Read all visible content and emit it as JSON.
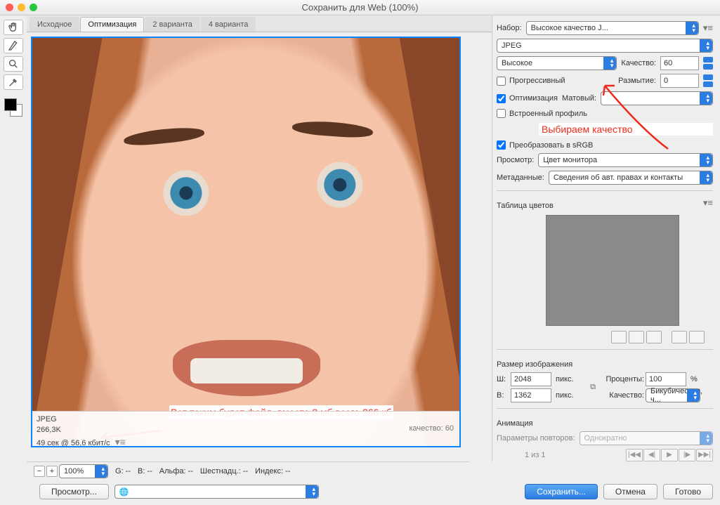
{
  "window": {
    "title": "Сохранить для Web (100%)"
  },
  "tabs": {
    "t1": "Исходное",
    "t2": "Оптимизация",
    "t3": "2 варианта",
    "t4": "4 варианта"
  },
  "preview_info": {
    "format": "JPEG",
    "size": "266,3K",
    "time": "49 сек @ 56,6 кбит/с",
    "quality_line": "качество: 60"
  },
  "annotation1": "Вот таким будет файл, вместе 8 мб всего 266 кб",
  "annotation2": "Выбираем качество",
  "settings": {
    "preset_label": "Набор:",
    "preset": "Высокое качество J...",
    "format": "JPEG",
    "quality_preset": "Высокое",
    "quality_label": "Качество:",
    "quality_value": "60",
    "progressive": "Прогрессивный",
    "blur_label": "Размытие:",
    "blur_value": "0",
    "optimization": "Оптимизация",
    "matte_label": "Матовый:",
    "embedded_profile": "Встроенный профиль",
    "convert_srgb": "Преобразовать в sRGB",
    "preview_label": "Просмотр:",
    "preview": "Цвет монитора",
    "metadata_label": "Метаданные:",
    "metadata": "Сведения об авт. правах и контакты",
    "color_table": "Таблица цветов"
  },
  "image_size": {
    "title": "Размер изображения",
    "w_label": "Ш:",
    "w": "2048",
    "h_label": "В:",
    "h": "1362",
    "px": "пикс.",
    "percent_label": "Проценты:",
    "percent": "100",
    "percent_sign": "%",
    "quality_label": "Качество:",
    "resample": "Бикубическая, ч..."
  },
  "animation": {
    "title": "Анимация",
    "loop_label": "Параметры повторов:",
    "loop": "Однократно",
    "frame": "1 из 1"
  },
  "bottombar": {
    "zoom": "100%",
    "g": "G: --",
    "b": "B: --",
    "alpha": "Альфа: --",
    "hex": "Шестнадц.: --",
    "index": "Индекс: --"
  },
  "buttons": {
    "preview": "Просмотр...",
    "save": "Сохранить...",
    "cancel": "Отмена",
    "done": "Готово"
  }
}
